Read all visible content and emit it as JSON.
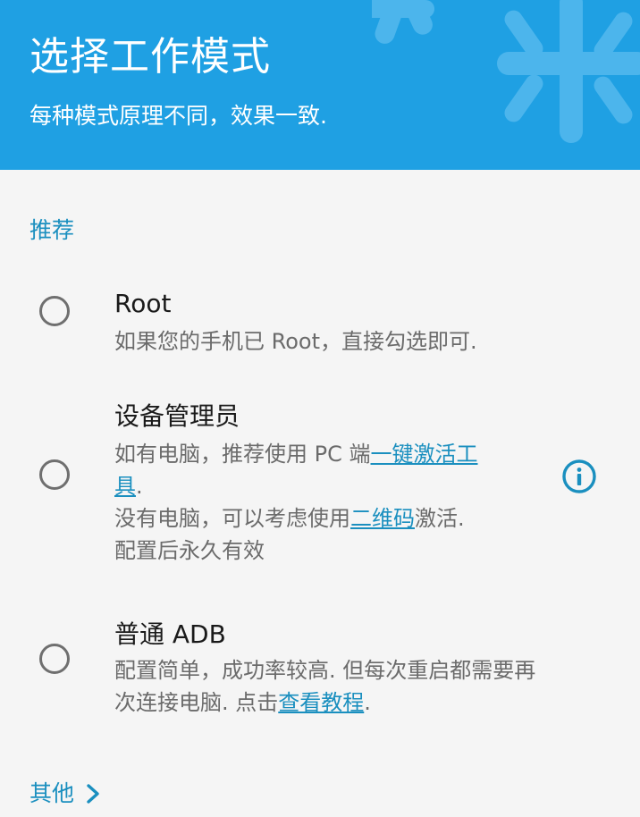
{
  "header": {
    "title": "选择工作模式",
    "subtitle": "每种模式原理不同，效果一致."
  },
  "section": {
    "recommended_label": "推荐",
    "other_label": "其他"
  },
  "options": [
    {
      "title": "Root",
      "desc": "如果您的手机已 Root，直接勾选即可."
    },
    {
      "title": "设备管理员",
      "line1_prefix": "如有电脑，推荐使用 PC 端",
      "line1_link": "一键激活工",
      "line2_link": "具",
      "line2_suffix": ".",
      "line3_prefix": "没有电脑，可以考虑使用",
      "line3_link": "二维码",
      "line3_suffix": "激活.",
      "line4": "配置后永久有效"
    },
    {
      "title": "普通 ADB",
      "line1": "配置简单，成功率较高. 但每次重启都需要再",
      "line2_prefix": "次连接电脑. 点击",
      "line2_link": "查看教程",
      "line2_suffix": "."
    }
  ],
  "colors": {
    "header_bg": "#1fa0e3",
    "accent": "#1a8fbf",
    "radio_border": "#6f6f6f"
  },
  "icons": {
    "info": "info-icon",
    "chevron": "chevron-right-icon",
    "header_decoration": "snowflake-icon"
  }
}
